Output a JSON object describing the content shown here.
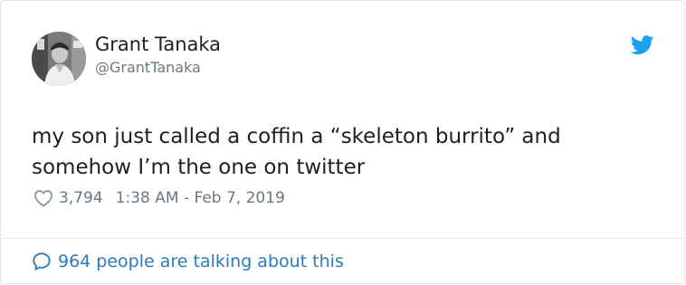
{
  "author": {
    "name": "Grant Tanaka",
    "handle": "@GrantTanaka"
  },
  "tweet": {
    "text_lines": [
      "my son just called a coffin a “skeleton burrito” and",
      "somehow I’m the one on twitter"
    ],
    "likes": "3,794",
    "timestamp": "1:38 AM - Feb 7, 2019"
  },
  "footer": {
    "talking_text": "964 people are talking about this"
  },
  "colors": {
    "twitter_blue": "#1da1f2",
    "link_blue": "#2b7bb9",
    "text": "#1c2022",
    "muted": "#697882",
    "border": "#e1e8ed"
  },
  "icons": {
    "logo": "twitter-bird-icon",
    "like": "heart-outline-icon",
    "conversation": "speech-bubble-icon"
  }
}
